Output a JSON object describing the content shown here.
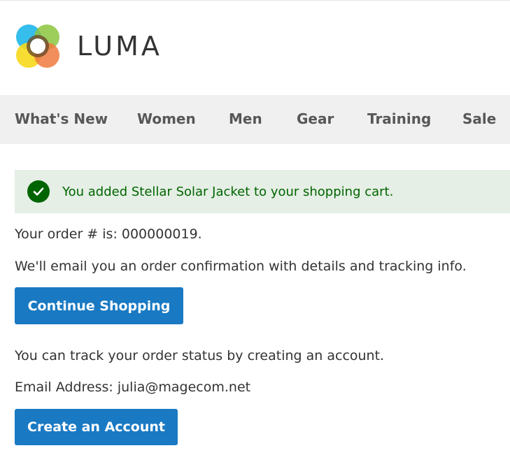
{
  "logo": {
    "text": "LUMA"
  },
  "nav": {
    "items": [
      "What's New",
      "Women",
      "Men",
      "Gear",
      "Training",
      "Sale"
    ]
  },
  "message": {
    "text": "You added Stellar Solar Jacket to your shopping cart."
  },
  "order": {
    "number_line": "Your order # is: 000000019.",
    "email_line": "We'll email you an order confirmation with details and tracking info.",
    "continue_label": "Continue Shopping"
  },
  "account": {
    "track_line": "You can track your order status by creating an account.",
    "email_address_line": "Email Address: julia@magecom.net",
    "create_label": "Create an Account"
  },
  "colors": {
    "primary": "#1979c3",
    "success_bg": "#e5efe5",
    "success_text": "#006400",
    "nav_bg": "#f0f0f0"
  }
}
